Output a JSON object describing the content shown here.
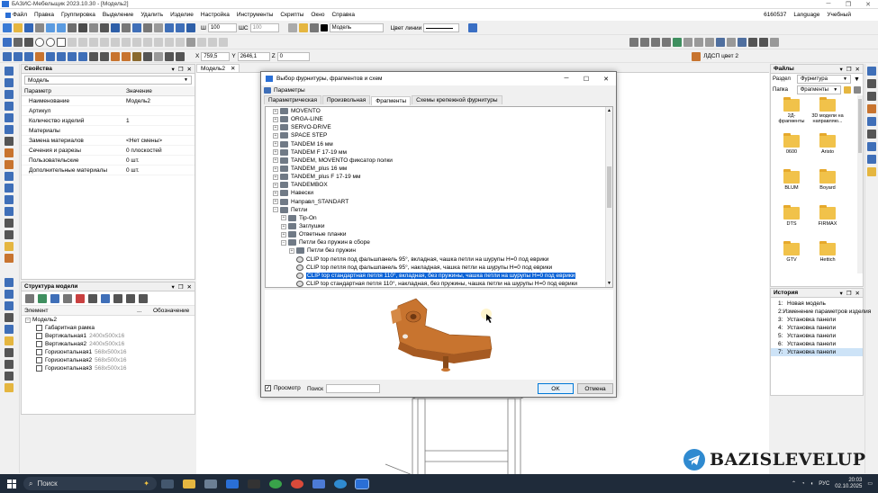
{
  "window": {
    "title": "БАЗИС-Мебельщик 2023.10.30 - [Модель2]"
  },
  "menu": {
    "items": [
      "Файл",
      "Правка",
      "Группировка",
      "Выделение",
      "Удалить",
      "Изделие",
      "Настройка",
      "Инструменты",
      "Скрипты",
      "Окно",
      "Справка"
    ],
    "right": [
      "6160537",
      "Language",
      "Учебный"
    ]
  },
  "toolbar": {
    "step_label": "Ш",
    "step_value": "100",
    "shc_label": "ШС",
    "shc_value": "100",
    "layer_value": "Модель",
    "line_color_label": "Цвет линии",
    "coord_x_label": "X",
    "coord_x": "759,5",
    "coord_y_label": "Y",
    "coord_y": "2646,1",
    "coord_z_label": "Z",
    "coord_z": "0",
    "material_label": "ЛДСП цвет 2"
  },
  "properties": {
    "title": "Свойства",
    "selector": "Модель",
    "col_param": "Параметр",
    "col_value": "Значение",
    "rows": [
      {
        "k": "Наименование",
        "v": "Модель2"
      },
      {
        "k": "Артикул",
        "v": ""
      },
      {
        "k": "Количество изделий",
        "v": "1"
      },
      {
        "k": "Материалы",
        "v": ""
      },
      {
        "k": "Замена материалов",
        "v": "<Нет смены>"
      },
      {
        "k": "Сечения и разрезы",
        "v": "0 плоскостей"
      },
      {
        "k": "Пользовательские",
        "v": "0 шт."
      },
      {
        "k": "Дополнительные материалы",
        "v": "0 шт."
      }
    ]
  },
  "structure": {
    "title": "Структура модели",
    "col_element": "Элемент",
    "col_more": "...",
    "col_designation": "Обозначение",
    "root": "Модель2",
    "items": [
      {
        "name": "Габаритная рамка",
        "dim": ""
      },
      {
        "name": "Вертикальная1",
        "dim": "2400x500x16"
      },
      {
        "name": "Вертикальная2",
        "dim": "2400x500x16"
      },
      {
        "name": "Горизонтальная1",
        "dim": "568x500x16"
      },
      {
        "name": "Горизонтальная2",
        "dim": "568x500x16"
      },
      {
        "name": "Горизонтальная3",
        "dim": "568x500x16"
      }
    ]
  },
  "doc_tab": {
    "label": "Модель2"
  },
  "dialog": {
    "title": "Выбор фурнитуры, фрагментов и схем",
    "params_label": "Параметры",
    "tabs": [
      "Параметрическая",
      "Произвольная",
      "Фрагменты",
      "Схемы крепежной фурнитуры"
    ],
    "active_tab": 2,
    "tree": [
      {
        "d": 1,
        "t": "MOVENTO",
        "e": "+",
        "k": "f"
      },
      {
        "d": 1,
        "t": "ORGA-LINE",
        "e": "+",
        "k": "f"
      },
      {
        "d": 1,
        "t": "SERVO-DRIVE",
        "e": "+",
        "k": "f"
      },
      {
        "d": 1,
        "t": "SPACE STEP",
        "e": "+",
        "k": "f"
      },
      {
        "d": 1,
        "t": "TANDEM 16 мм",
        "e": "+",
        "k": "f"
      },
      {
        "d": 1,
        "t": "TANDEM F 17-19 мм",
        "e": "+",
        "k": "f"
      },
      {
        "d": 1,
        "t": "TANDEM, MOVENTO фиксатор полки",
        "e": "+",
        "k": "f"
      },
      {
        "d": 1,
        "t": "TANDEM_plus 16 мм",
        "e": "+",
        "k": "f"
      },
      {
        "d": 1,
        "t": "TANDEM_plus F 17-19 мм",
        "e": "+",
        "k": "f"
      },
      {
        "d": 1,
        "t": "TANDEMBOX",
        "e": "+",
        "k": "f"
      },
      {
        "d": 1,
        "t": "Навески",
        "e": "+",
        "k": "f"
      },
      {
        "d": 1,
        "t": "Направл_STANDART",
        "e": "+",
        "k": "f"
      },
      {
        "d": 1,
        "t": "Петли",
        "e": "-",
        "k": "f"
      },
      {
        "d": 2,
        "t": "Tip-On",
        "e": "+",
        "k": "f"
      },
      {
        "d": 2,
        "t": "Заглушки",
        "e": "+",
        "k": "f"
      },
      {
        "d": 2,
        "t": "Ответные планки",
        "e": "+",
        "k": "f"
      },
      {
        "d": 2,
        "t": "Петли без пружин в сборе",
        "e": "-",
        "k": "f"
      },
      {
        "d": 3,
        "t": "Петли без пружин",
        "e": "+",
        "k": "f"
      },
      {
        "d": 3,
        "t": "CLIP top петля под фальшпанель 95°, вкладная, чашка петли на шурупы H=0 под еврики",
        "e": "",
        "k": "i"
      },
      {
        "d": 3,
        "t": "CLIP top петля под фальшпанель 95°, накладная, чашка петли на шурупы H=0 под еврики",
        "e": "",
        "k": "i"
      },
      {
        "d": 3,
        "t": "CLIP top стандартная петля 110°, вкладная, без пружины, чашка петли на шурупы H=0 под еврики",
        "e": "",
        "k": "i",
        "sel": true
      },
      {
        "d": 3,
        "t": "CLIP top стандартная петля 110°, накладная, без пружины, чашка петли на шурупы H=0 под еврики",
        "e": "",
        "k": "i"
      }
    ],
    "preview_label": "Просмотр",
    "preview_checked": true,
    "search_label": "Поиск",
    "search_value": "",
    "ok_label": "OK",
    "cancel_label": "Отмена"
  },
  "files": {
    "title": "Файлы",
    "section_label": "Раздел",
    "section_value": "Фурнитура",
    "folder_label": "Папка",
    "folder_value": "Фрагменты",
    "items": [
      "2Д-фрагменты",
      "3D модели на направляю...",
      "0600",
      "Aristo",
      "BLUM",
      "Boyard",
      "DTS",
      "FIRMAX",
      "GTV",
      "Hettich"
    ]
  },
  "history": {
    "title": "История",
    "items": [
      {
        "n": "1:",
        "t": "Новая модель"
      },
      {
        "n": "2:",
        "t": "Изменение параметров изделия"
      },
      {
        "n": "3:",
        "t": "Установка панели"
      },
      {
        "n": "4:",
        "t": "Установка панели"
      },
      {
        "n": "5:",
        "t": "Установка панели"
      },
      {
        "n": "6:",
        "t": "Установка панели"
      },
      {
        "n": "7:",
        "t": "Установка панели"
      }
    ],
    "selected_index": 6
  },
  "watermark": {
    "text": "BAZISLEVELUP"
  },
  "taskbar": {
    "search_label": "Поиск",
    "lang": "РУС",
    "time": "20:03",
    "date": "02.10.2025"
  },
  "colors": {
    "accent": "#0a62d6",
    "folder": "#f1c24a",
    "hinge": "#c8742f",
    "taskbar": "#1f2b3a"
  }
}
